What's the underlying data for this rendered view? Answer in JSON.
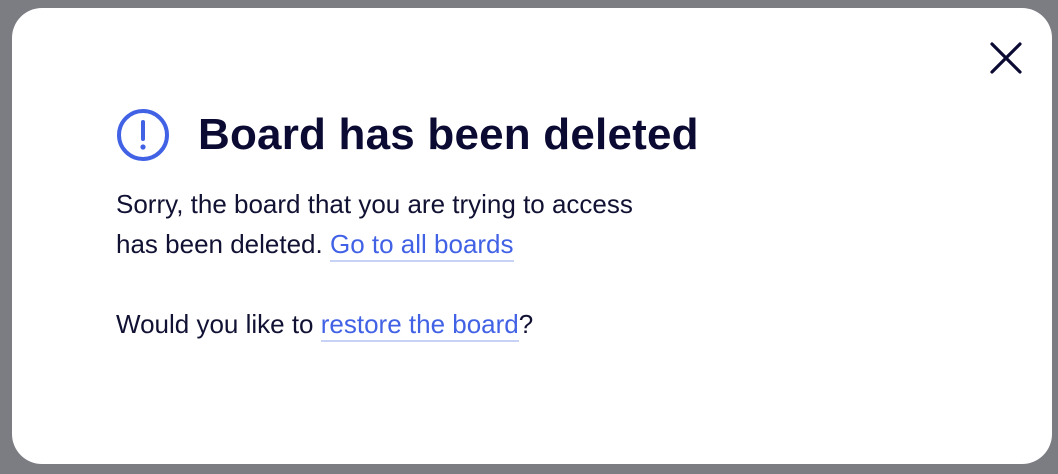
{
  "dialog": {
    "title": "Board has been deleted",
    "message_line1": "Sorry, the board that you are trying to access",
    "message_line2": "has been deleted.",
    "go_to_boards_link": "Go to all boards",
    "restore_prefix": "Would you like to",
    "restore_link": "restore the board",
    "restore_suffix": "?"
  },
  "icons": {
    "warning": "exclamation-circle-icon",
    "close": "close-icon"
  },
  "colors": {
    "accent": "#4262e6",
    "title": "#0b0a33",
    "backdrop": "#7c7d82"
  }
}
